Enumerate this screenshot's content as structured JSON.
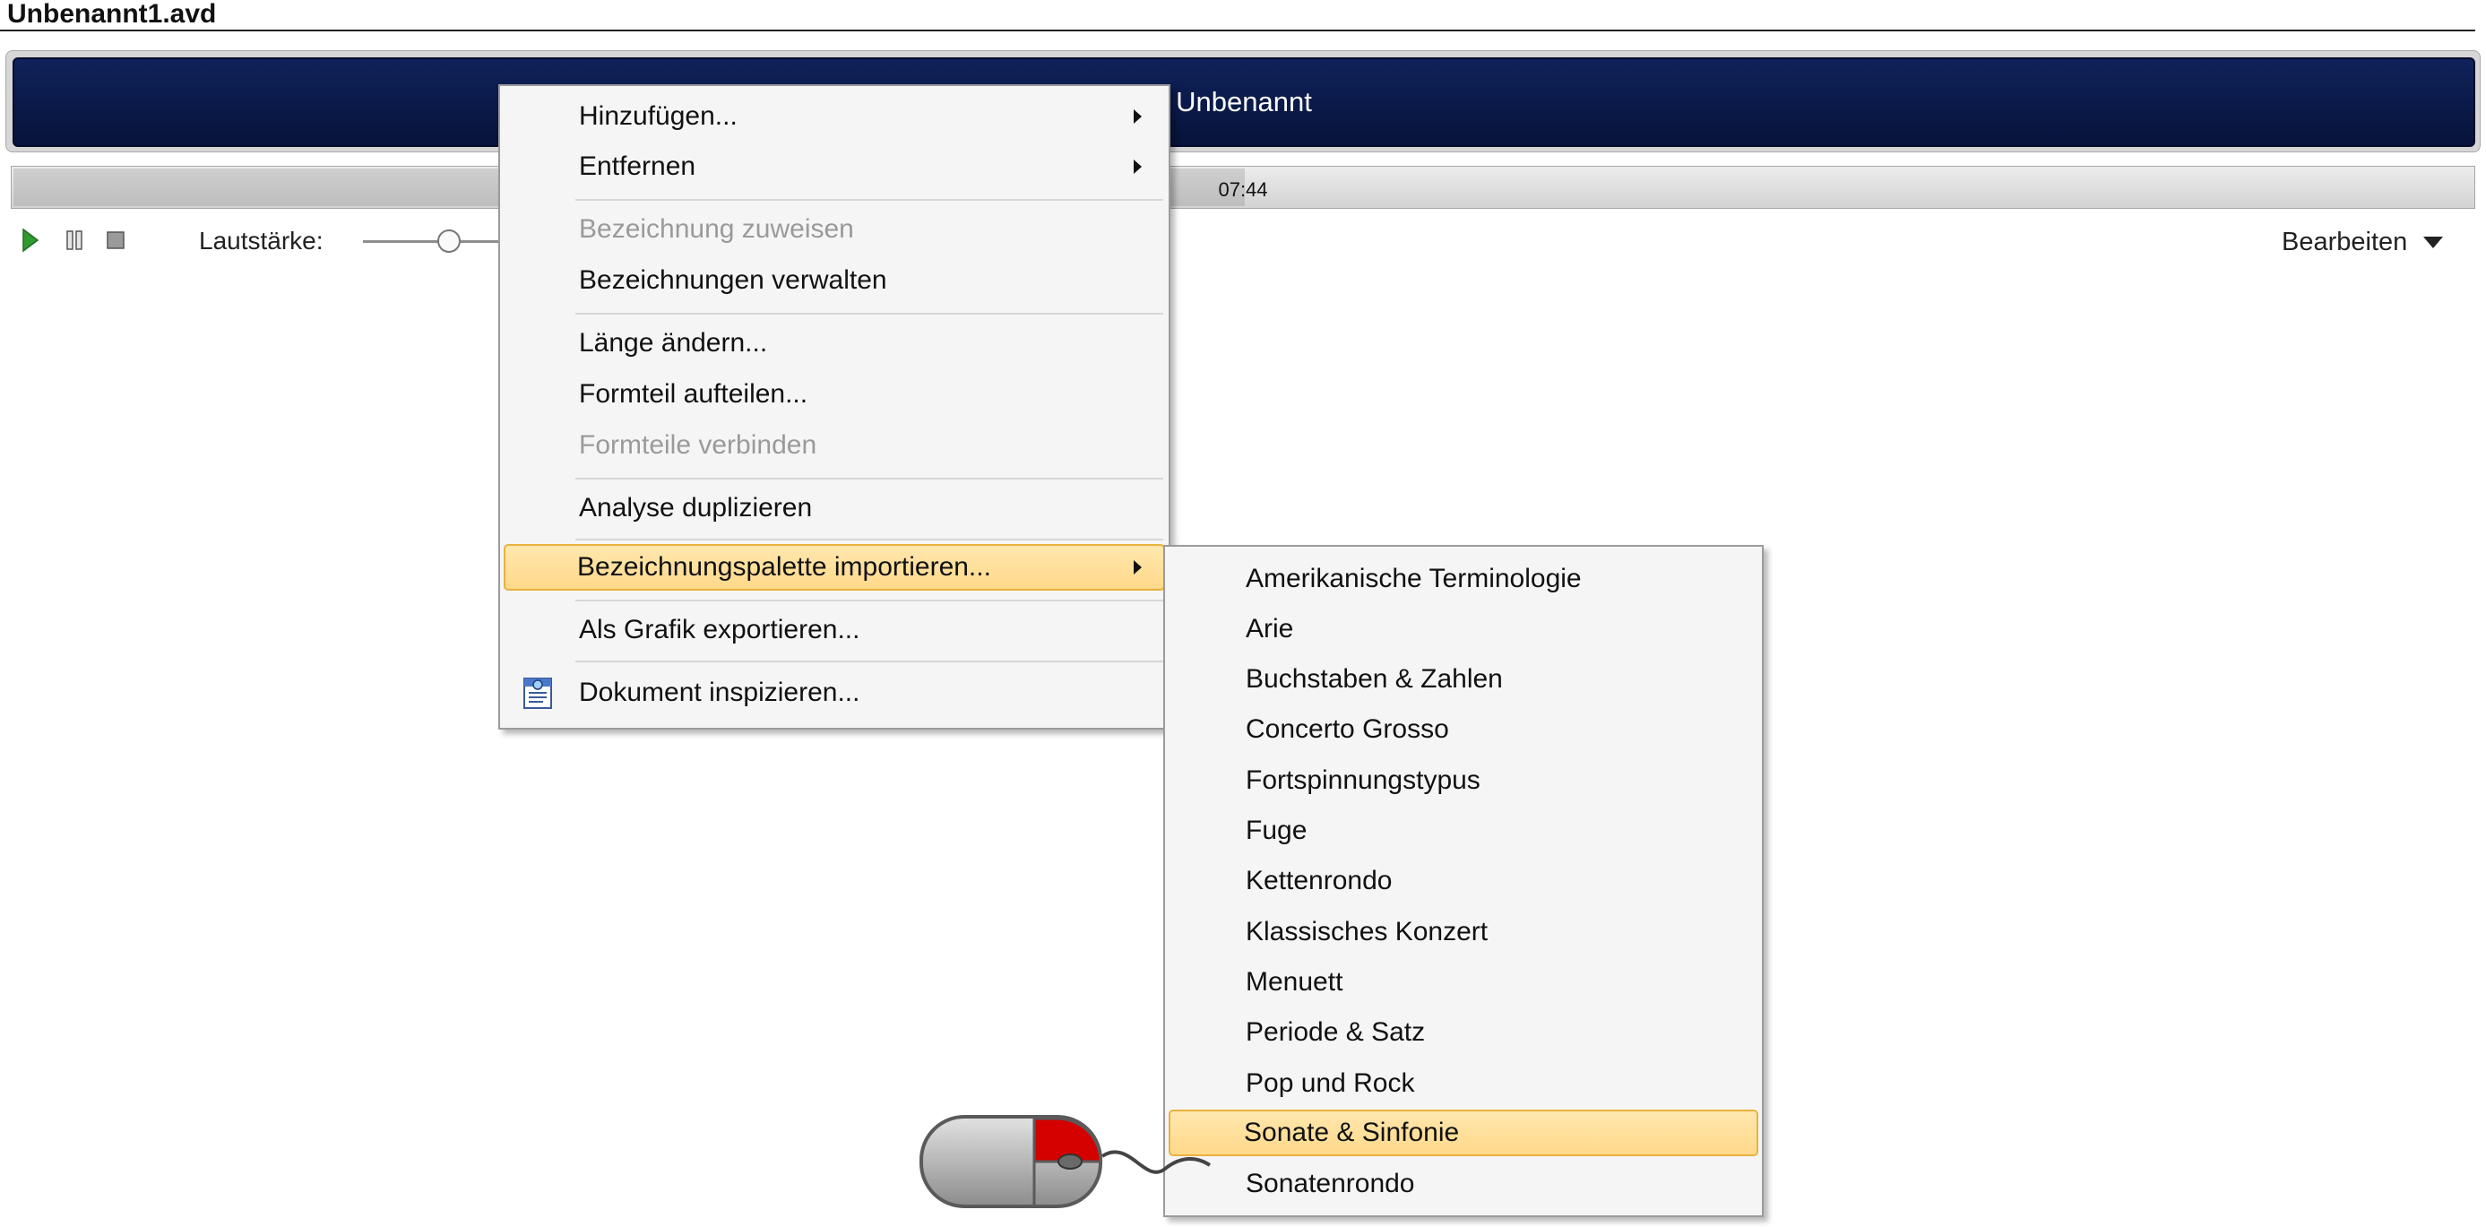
{
  "document": {
    "title": "Unbenannt1.avd"
  },
  "piece_title": "Unbenannt",
  "playback": {
    "time": "07:44",
    "progress_percent": 50,
    "volume_label": "Lautstärke:",
    "volume_level": 0.62,
    "play_icon": "play-icon",
    "pause_icon": "pause-icon",
    "stop_icon": "stop-icon"
  },
  "edit_menu": {
    "label": "Bearbeiten"
  },
  "context_menu": {
    "items": [
      {
        "label": "Hinzufügen...",
        "submenu": true,
        "enabled": true
      },
      {
        "label": "Entfernen",
        "submenu": true,
        "enabled": true
      },
      {
        "label": "Bezeichnung zuweisen",
        "enabled": false
      },
      {
        "label": "Bezeichnungen verwalten",
        "enabled": true
      },
      {
        "label": "Länge ändern...",
        "enabled": true
      },
      {
        "label": "Formteil aufteilen...",
        "enabled": true
      },
      {
        "label": "Formteile verbinden",
        "enabled": false
      },
      {
        "label": "Analyse duplizieren",
        "enabled": true
      },
      {
        "label": "Bezeichnungspalette importieren...",
        "submenu": true,
        "enabled": true,
        "highlighted": true
      },
      {
        "label": "Als Grafik exportieren...",
        "enabled": true
      },
      {
        "label": "Dokument inspizieren...",
        "enabled": true,
        "icon": "document-inspect-icon"
      }
    ]
  },
  "palette_submenu": {
    "items": [
      {
        "label": "Amerikanische Terminologie"
      },
      {
        "label": "Arie"
      },
      {
        "label": "Buchstaben & Zahlen"
      },
      {
        "label": "Concerto Grosso"
      },
      {
        "label": "Fortspinnungstypus"
      },
      {
        "label": "Fuge"
      },
      {
        "label": "Kettenrondo"
      },
      {
        "label": "Klassisches Konzert"
      },
      {
        "label": "Menuett"
      },
      {
        "label": "Periode & Satz"
      },
      {
        "label": "Pop und Rock"
      },
      {
        "label": "Sonate & Sinfonie",
        "highlighted": true
      },
      {
        "label": "Sonatenrondo"
      }
    ]
  },
  "colors": {
    "title_bar": "#0b1b4c",
    "highlight": "#ffdc8f",
    "highlight_border": "#e9b23e",
    "play_green": "#2f9a2f",
    "mouse_button_pressed": "#d50000"
  },
  "overlay": {
    "mouse_icon": "mouse-left-click-icon"
  }
}
